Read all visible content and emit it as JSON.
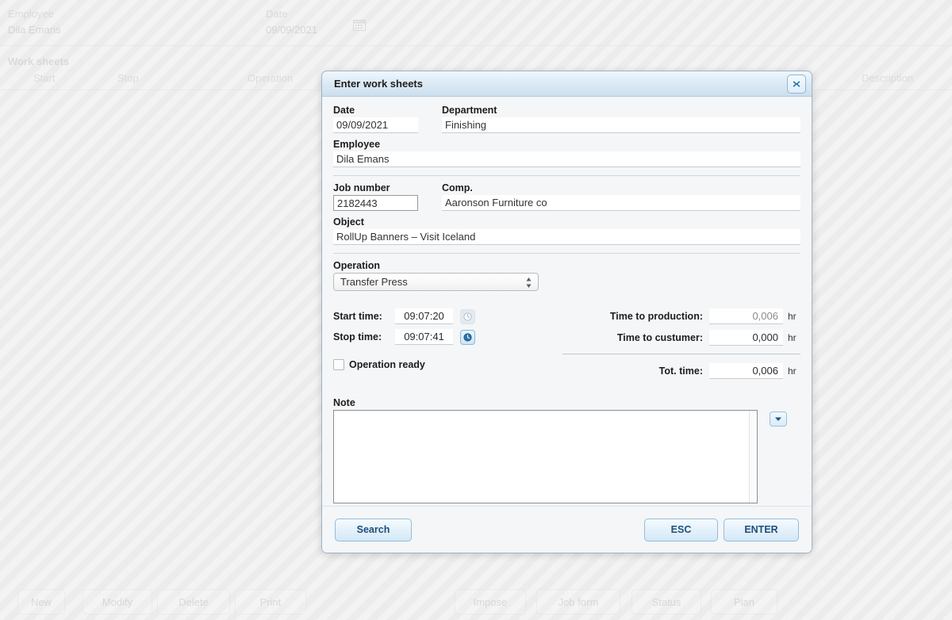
{
  "background": {
    "employee_label": "Employee",
    "employee_value": "Dila Emans",
    "date_label": "Date",
    "date_value": "09/09/2021",
    "calendar_icon": "calendar-icon",
    "section_title": "Work sheets",
    "columns": [
      "Start",
      "Stop",
      "Operation",
      "Description"
    ],
    "toolbar": [
      {
        "label": "New"
      },
      {
        "label": "Modify"
      },
      {
        "label": "Delete"
      },
      {
        "label": "Print"
      },
      {
        "label": "Impose"
      },
      {
        "label": "Job form"
      },
      {
        "label": "Status"
      },
      {
        "label": "Plan"
      }
    ]
  },
  "dialog": {
    "title": "Enter work sheets",
    "close_icon": "close-icon",
    "fields": {
      "date_label": "Date",
      "date_value": "09/09/2021",
      "department_label": "Department",
      "department_value": "Finishing",
      "employee_label": "Employee",
      "employee_value": "Dila Emans",
      "job_number_label": "Job number",
      "job_number_value": "2182443",
      "comp_label": "Comp.",
      "comp_value": "Aaronson Furniture co",
      "object_label": "Object",
      "object_value": "RollUp Banners – Visit Iceland",
      "operation_label": "Operation",
      "operation_value": "Transfer Press"
    },
    "times": {
      "start_label": "Start time:",
      "start_value": "09:07:20",
      "start_clock_icon": "clock-icon",
      "stop_label": "Stop time:",
      "stop_value": "09:07:41",
      "stop_clock_icon": "clock-icon",
      "operation_ready_label": "Operation ready"
    },
    "totals": {
      "production_label": "Time to production:",
      "production_value": "0,006",
      "customer_label": "Time to custumer:",
      "customer_value": "0,000",
      "total_label": "Tot. time:",
      "total_value": "0,006",
      "unit": "hr"
    },
    "note": {
      "label": "Note",
      "value": "",
      "dropdown_icon": "chevron-down-icon"
    },
    "buttons": {
      "search": "Search",
      "esc": "ESC",
      "enter": "ENTER"
    }
  }
}
